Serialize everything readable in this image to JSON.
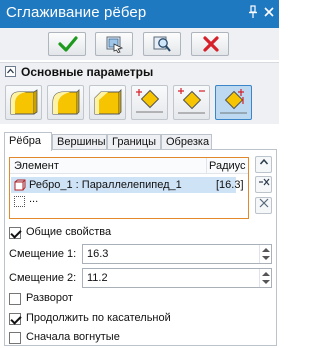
{
  "window": {
    "title": "Сглаживание рёбер",
    "pin_icon": "pin-icon",
    "close_icon": "close-icon"
  },
  "actions": [
    {
      "name": "ok-button",
      "icon": "check-icon"
    },
    {
      "name": "apply-preview-button",
      "icon": "preview-icon"
    },
    {
      "name": "zoom-preview-button",
      "icon": "magnifier-icon"
    },
    {
      "name": "cancel-button",
      "icon": "cross-icon"
    }
  ],
  "section": {
    "label": "Основные параметры"
  },
  "modes": [
    {
      "name": "fillet-mode-1",
      "selected": false
    },
    {
      "name": "fillet-mode-2",
      "selected": false
    },
    {
      "name": "fillet-mode-3",
      "selected": false
    },
    {
      "name": "fillet-mode-4",
      "selected": false
    },
    {
      "name": "fillet-mode-5",
      "selected": false
    },
    {
      "name": "fillet-mode-6",
      "selected": true
    }
  ],
  "tabs": [
    "Рёбра",
    "Вершины",
    "Границы",
    "Обрезка"
  ],
  "table": {
    "columns": [
      "Элемент",
      "Радиус"
    ],
    "rows": [
      {
        "element": "Ребро_1 : Параллелепипед_1",
        "radius": "[16.3]"
      },
      {
        "element": "...",
        "radius": ""
      }
    ]
  },
  "options": {
    "common_props_label": "Общие свойства",
    "common_props_checked": true,
    "offset1_label": "Смещение 1:",
    "offset1_value": "16.3",
    "offset2_label": "Смещение 2:",
    "offset2_value": "11.2",
    "reverse_label": "Разворот",
    "reverse_checked": false,
    "tangent_label": "Продолжить по касательной",
    "tangent_checked": true,
    "concave_first_label": "Сначала вогнутые",
    "concave_first_checked": false
  },
  "colors": {
    "titlebar": "#1f79c0",
    "accent_selection": "#cfe3f6",
    "table_border": "#e28a2b",
    "ok_green": "#1e9a1e",
    "cancel_red": "#d6202a"
  }
}
